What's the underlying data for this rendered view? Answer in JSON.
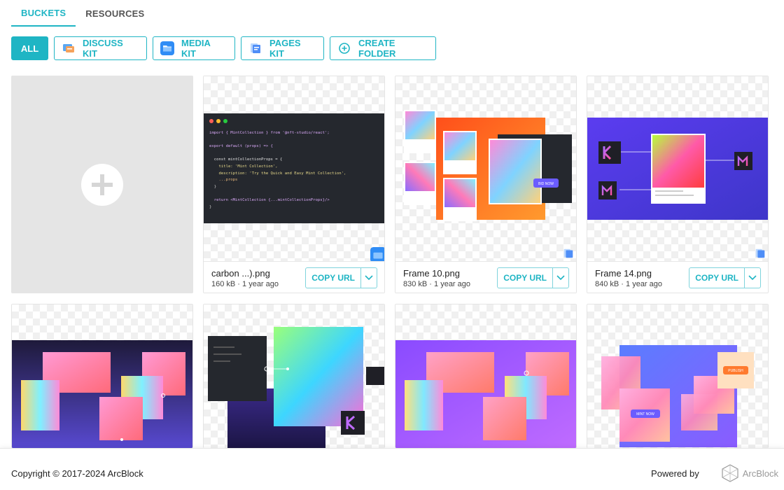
{
  "tabs": [
    {
      "label": "BUCKETS",
      "active": true
    },
    {
      "label": "RESOURCES",
      "active": false
    }
  ],
  "filters": {
    "all": "ALL",
    "discuss_kit": "DISCUSS KIT",
    "media_kit": "MEDIA KIT",
    "pages_kit": "PAGES KIT",
    "create_folder": "CREATE FOLDER"
  },
  "files": [
    {
      "name": "carbon ...).png",
      "info": "160 kB · 1 year ago",
      "copy_label": "COPY URL",
      "source_icon": "media-kit-icon"
    },
    {
      "name": "Frame 10.png",
      "info": "830 kB · 1 year ago",
      "copy_label": "COPY URL",
      "source_icon": "pages-kit-icon"
    },
    {
      "name": "Frame 14.png",
      "info": "840 kB · 1 year ago",
      "copy_label": "COPY URL",
      "source_icon": "pages-kit-icon"
    }
  ],
  "code_preview": {
    "lines": [
      "import { MintCollection } from '@nft-studio/react';",
      "",
      "export default (props) => {",
      "",
      "  const mintCollectionProps = {",
      "    title: 'Mint Collection',",
      "    description: 'Try the Quick and Easy Mint Collection',",
      "    ...props",
      "  }",
      "",
      "  return <MintCollection {...mintCollectionProps}/>",
      "}"
    ]
  },
  "thumb_labels": {
    "bid_now": "BID NOW",
    "mint_now": "MINT NOW",
    "publish": "PUBLISH"
  },
  "footer": {
    "copyright": "Copyright © 2017-2024  ArcBlock",
    "powered_by": "Powered by",
    "brand": "ArcBlock"
  },
  "colors": {
    "accent": "#1fb5c4"
  }
}
